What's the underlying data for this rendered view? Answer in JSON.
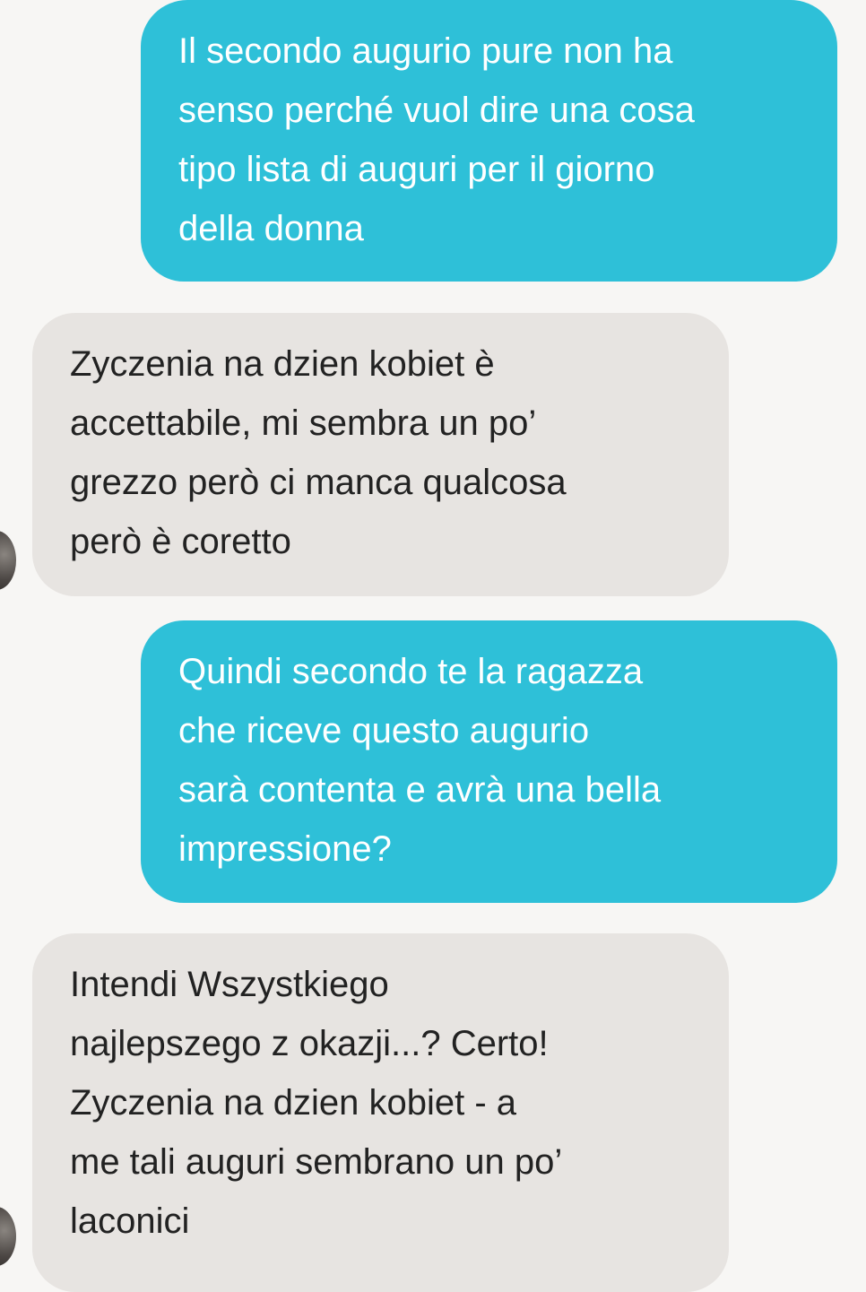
{
  "messages": [
    {
      "direction": "outgoing",
      "text": "Il secondo augurio pure non ha\nsenso perché vuol dire una cosa\ntipo lista di auguri per il giorno\ndella donna"
    },
    {
      "direction": "incoming",
      "text": "Zyczenia na dzien kobiet è\naccettabile, mi sembra un po’\ngrezzo però ci manca qualcosa\nperò è coretto"
    },
    {
      "direction": "outgoing",
      "text": "Quindi secondo te la ragazza\nche riceve questo augurio\nsarà contenta e avrà una bella\nimpressione?"
    },
    {
      "direction": "incoming",
      "text": "Intendi Wszystkiego\nnajlepszego z okazji...? Certo!\nZyczenia na dzien kobiet - a\nme tali auguri sembrano un po’\nlaconici"
    }
  ],
  "colors": {
    "background": "#f7f6f4",
    "outgoing_bubble": "#2ec0d8",
    "incoming_bubble": "#e7e4e1",
    "outgoing_text": "#ffffff",
    "incoming_text": "#222222"
  }
}
